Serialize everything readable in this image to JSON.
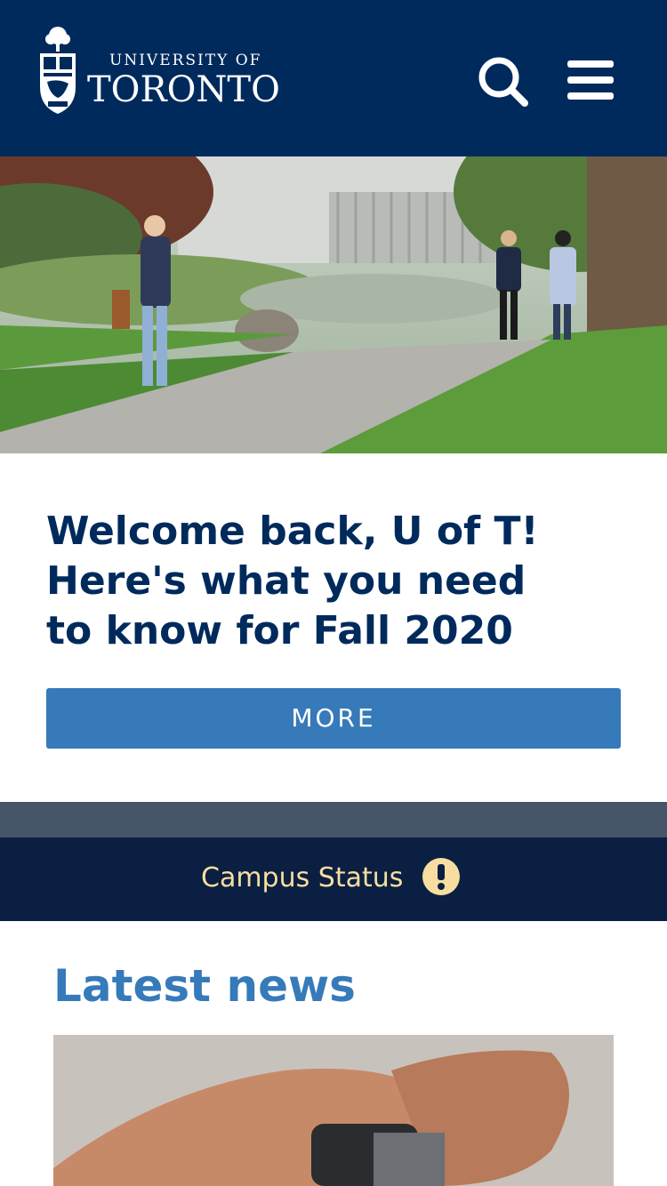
{
  "header": {
    "logo_line1": "UNIVERSITY OF",
    "logo_line2": "TORONTO"
  },
  "hero": {
    "headline_line1": "Welcome back, U of T!",
    "headline_line2": "Here's what you need",
    "headline_line3": "to know for Fall 2020",
    "more_label": "MORE"
  },
  "status": {
    "label": "Campus Status",
    "icon": "exclamation-circle-icon"
  },
  "news": {
    "title": "Latest news"
  },
  "colors": {
    "brand_navy": "#002a5c",
    "accent_blue": "#367ab9",
    "status_bg": "#0b1f42",
    "status_text": "#f7dea0"
  }
}
